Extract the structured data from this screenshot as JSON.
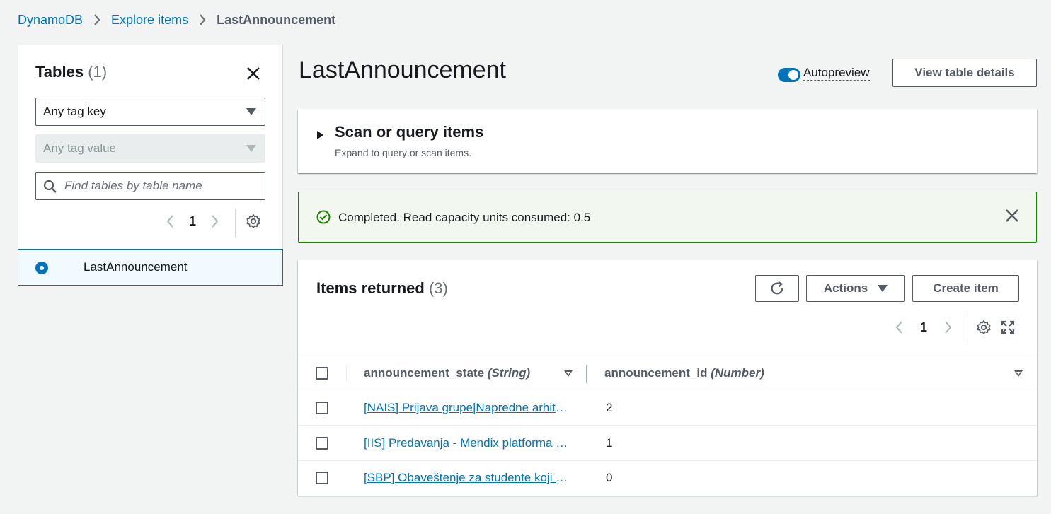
{
  "breadcrumb": {
    "items": [
      "DynamoDB",
      "Explore items"
    ],
    "current": "LastAnnouncement"
  },
  "sidebar": {
    "title": "Tables",
    "count": "(1)",
    "tag_key": "Any tag key",
    "tag_value": "Any tag value",
    "search_placeholder": "Find tables by table name",
    "page": "1",
    "tables": [
      {
        "name": "LastAnnouncement",
        "selected": true
      }
    ]
  },
  "main": {
    "title": "LastAnnouncement",
    "autopreview_label": "Autopreview",
    "view_details_label": "View table details",
    "scan": {
      "heading": "Scan or query items",
      "subtext": "Expand to query or scan items."
    },
    "alert": {
      "message": "Completed. Read capacity units consumed: 0.5"
    },
    "items": {
      "heading": "Items returned",
      "count": "(3)",
      "actions_label": "Actions",
      "create_label": "Create item",
      "page": "1",
      "columns": [
        {
          "name": "announcement_state",
          "type": "(String)"
        },
        {
          "name": "announcement_id",
          "type": "(Number)"
        }
      ],
      "rows": [
        {
          "state": "[NAIS] Prijava grupe|Napredne arhitekture informacionih sistema",
          "id": "2"
        },
        {
          "state": "[IIS] Predavanja - Mendix platforma za razvoj aplikacija",
          "id": "1"
        },
        {
          "state": "[SBP] Obaveštenje za studente koji polažu ispit",
          "id": "0"
        }
      ]
    }
  },
  "colors": {
    "link": "#0073bb",
    "success": "#1d8102",
    "background": "#f2f3f3"
  }
}
